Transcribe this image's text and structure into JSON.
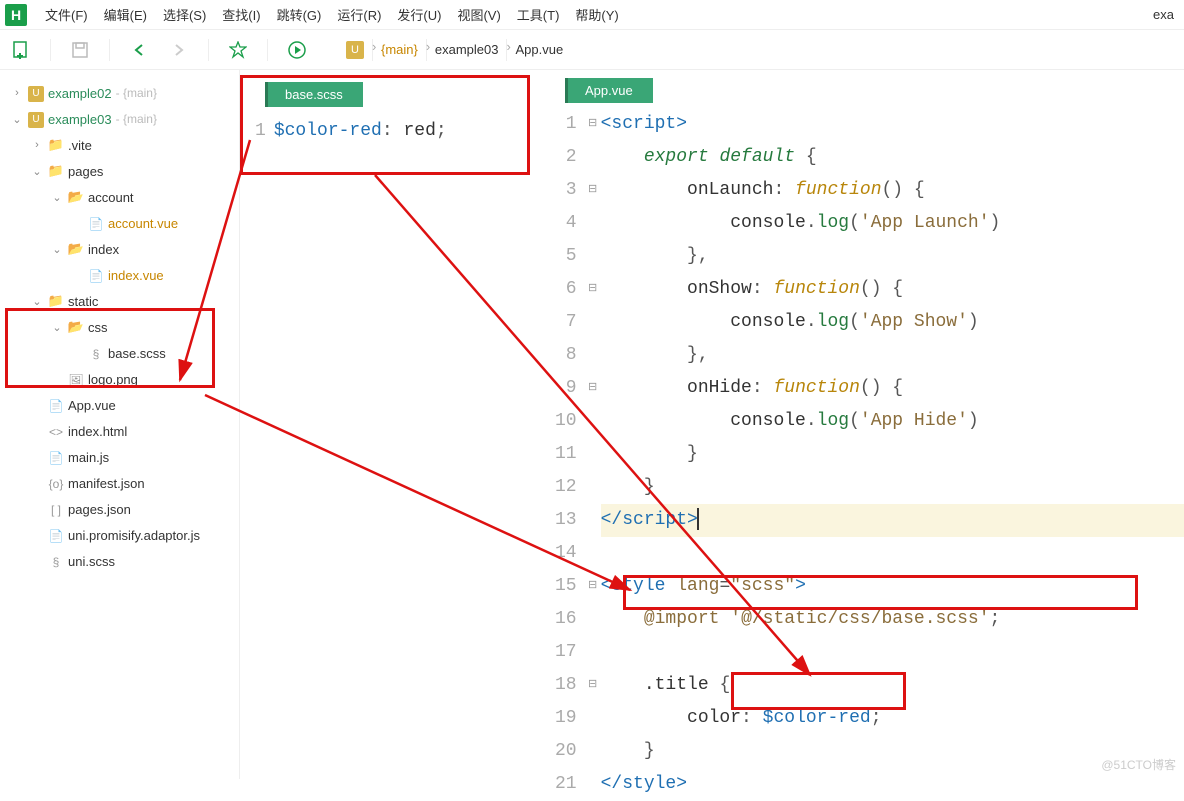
{
  "menu": [
    "文件(F)",
    "编辑(E)",
    "选择(S)",
    "查找(I)",
    "跳转(G)",
    "运行(R)",
    "发行(U)",
    "视图(V)",
    "工具(T)",
    "帮助(Y)"
  ],
  "top_right": "exa",
  "breadcrumb": {
    "items": [
      "{main}",
      "example03",
      "App.vue"
    ]
  },
  "tree": [
    {
      "d": 0,
      "tw": ">",
      "ico": "proj",
      "lbl": "example02",
      "cls": "green",
      "branch": "- {main}"
    },
    {
      "d": 0,
      "tw": "v",
      "ico": "proj",
      "lbl": "example03",
      "cls": "green",
      "branch": "- {main}"
    },
    {
      "d": 1,
      "tw": ">",
      "ico": "fold",
      "lbl": ".vite"
    },
    {
      "d": 1,
      "tw": "v",
      "ico": "fold",
      "lbl": "pages"
    },
    {
      "d": 2,
      "tw": "v",
      "ico": "fold-o",
      "lbl": "account"
    },
    {
      "d": 3,
      "tw": "",
      "ico": "file",
      "lbl": "account.vue",
      "cls": "orange"
    },
    {
      "d": 2,
      "tw": "v",
      "ico": "fold-o",
      "lbl": "index"
    },
    {
      "d": 3,
      "tw": "",
      "ico": "file",
      "lbl": "index.vue",
      "cls": "orange"
    },
    {
      "d": 1,
      "tw": "v",
      "ico": "fold",
      "lbl": "static"
    },
    {
      "d": 2,
      "tw": "v",
      "ico": "fold-o",
      "lbl": "css"
    },
    {
      "d": 3,
      "tw": "",
      "ico": "scss",
      "lbl": "base.scss"
    },
    {
      "d": 2,
      "tw": "",
      "ico": "img",
      "lbl": "logo.png"
    },
    {
      "d": 1,
      "tw": "",
      "ico": "file",
      "lbl": "App.vue"
    },
    {
      "d": 1,
      "tw": "",
      "ico": "code",
      "lbl": "index.html"
    },
    {
      "d": 1,
      "tw": "",
      "ico": "file",
      "lbl": "main.js"
    },
    {
      "d": 1,
      "tw": "",
      "ico": "json",
      "lbl": "manifest.json"
    },
    {
      "d": 1,
      "tw": "",
      "ico": "json2",
      "lbl": "pages.json"
    },
    {
      "d": 1,
      "tw": "",
      "ico": "file",
      "lbl": "uni.promisify.adaptor.js"
    },
    {
      "d": 1,
      "tw": "",
      "ico": "scss",
      "lbl": "uni.scss"
    }
  ],
  "tab_left": "base.scss",
  "tab_right": "App.vue",
  "code_left": {
    "lines": [
      {
        "n": 1,
        "html": "<span class='t-var'>$color-red</span><span class='t-punc'>:</span> <span class='t-prop'>red</span><span class='t-punc'>;</span>"
      }
    ]
  },
  "code_right": {
    "lines": [
      {
        "n": 1,
        "f": "⊟",
        "html": "<span class='t-tag'>&lt;script&gt;</span>"
      },
      {
        "n": 2,
        "f": "",
        "html": "    <span class='t-kw'>export default</span> <span class='t-punc'>{</span>"
      },
      {
        "n": 3,
        "f": "⊟",
        "html": "        <span class='t-prop'>onLaunch</span><span class='t-punc'>:</span> <span class='t-fn'>function</span><span class='t-punc'>() {</span>"
      },
      {
        "n": 4,
        "f": "",
        "html": "            <span class='t-prop'>console</span><span class='t-punc'>.</span><span class='t-kw2'>log</span><span class='t-punc'>(</span><span class='t-str'>'App Launch'</span><span class='t-punc'>)</span>"
      },
      {
        "n": 5,
        "f": "",
        "html": "        <span class='t-punc'>},</span>"
      },
      {
        "n": 6,
        "f": "⊟",
        "html": "        <span class='t-prop'>onShow</span><span class='t-punc'>:</span> <span class='t-fn'>function</span><span class='t-punc'>() {</span>"
      },
      {
        "n": 7,
        "f": "",
        "html": "            <span class='t-prop'>console</span><span class='t-punc'>.</span><span class='t-kw2'>log</span><span class='t-punc'>(</span><span class='t-str'>'App Show'</span><span class='t-punc'>)</span>"
      },
      {
        "n": 8,
        "f": "",
        "html": "        <span class='t-punc'>},</span>"
      },
      {
        "n": 9,
        "f": "⊟",
        "html": "        <span class='t-prop'>onHide</span><span class='t-punc'>:</span> <span class='t-fn'>function</span><span class='t-punc'>() {</span>"
      },
      {
        "n": 10,
        "f": "",
        "html": "            <span class='t-prop'>console</span><span class='t-punc'>.</span><span class='t-kw2'>log</span><span class='t-punc'>(</span><span class='t-str'>'App Hide'</span><span class='t-punc'>)</span>"
      },
      {
        "n": 11,
        "f": "",
        "html": "        <span class='t-punc'>}</span>"
      },
      {
        "n": 12,
        "f": "",
        "html": "    <span class='t-punc'>}</span>"
      },
      {
        "n": 13,
        "f": "",
        "hl": true,
        "html": "<span class='t-tag'>&lt;/script&gt;</span><span class='cursor'></span>"
      },
      {
        "n": 14,
        "f": "",
        "html": ""
      },
      {
        "n": 15,
        "f": "⊟",
        "html": "<span class='t-tag'>&lt;style</span> <span class='t-attr'>lang</span><span class='t-punc'>=</span><span class='t-str'>\"scss\"</span><span class='t-tag'>&gt;</span>"
      },
      {
        "n": 16,
        "f": "",
        "html": "    <span class='t-import'>@import</span> <span class='t-str'>'@/static/css/base.scss'</span><span class='t-punc'>;</span>"
      },
      {
        "n": 17,
        "f": "",
        "html": ""
      },
      {
        "n": 18,
        "f": "⊟",
        "html": "    <span class='t-prop'>.title</span> <span class='t-punc'>{</span>"
      },
      {
        "n": 19,
        "f": "",
        "html": "        <span class='t-prop'>color</span><span class='t-punc'>:</span> <span class='t-var'>$color-red</span><span class='t-punc'>;</span>"
      },
      {
        "n": 20,
        "f": "",
        "html": "    <span class='t-punc'>}</span>"
      },
      {
        "n": 21,
        "f": "",
        "html": "<span class='t-tag'>&lt;/style&gt;</span>"
      }
    ]
  },
  "watermark": "@51CTO博客"
}
